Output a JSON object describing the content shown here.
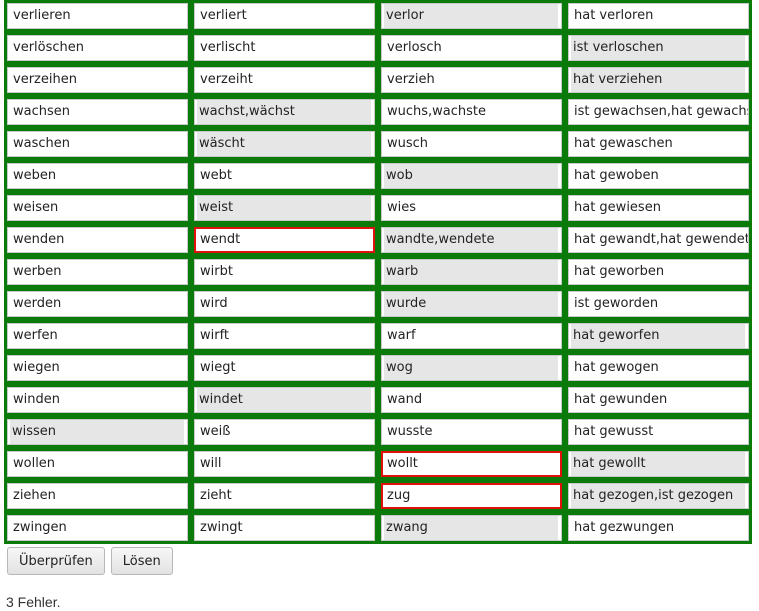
{
  "rows": [
    {
      "c": [
        {
          "t": "verlieren",
          "s": "given"
        },
        {
          "t": "verliert",
          "s": "given"
        },
        {
          "t": "verlor",
          "s": "ok"
        },
        {
          "t": "hat verloren",
          "s": "given"
        }
      ]
    },
    {
      "c": [
        {
          "t": "verlöschen",
          "s": "given"
        },
        {
          "t": "verlischt",
          "s": "given"
        },
        {
          "t": "verlosch",
          "s": "given"
        },
        {
          "t": "ist verloschen",
          "s": "ok"
        }
      ]
    },
    {
      "c": [
        {
          "t": "verzeihen",
          "s": "given"
        },
        {
          "t": "verzeiht",
          "s": "given"
        },
        {
          "t": "verzieh",
          "s": "given"
        },
        {
          "t": "hat verziehen",
          "s": "ok"
        }
      ]
    },
    {
      "c": [
        {
          "t": "wachsen",
          "s": "given"
        },
        {
          "t": "wachst,wächst",
          "s": "ok"
        },
        {
          "t": "wuchs,wachste",
          "s": "given"
        },
        {
          "t": "ist gewachsen,hat gewachst",
          "s": "given"
        }
      ]
    },
    {
      "c": [
        {
          "t": "waschen",
          "s": "given"
        },
        {
          "t": "wäscht",
          "s": "ok"
        },
        {
          "t": "wusch",
          "s": "given"
        },
        {
          "t": "hat gewaschen",
          "s": "given"
        }
      ]
    },
    {
      "c": [
        {
          "t": "weben",
          "s": "given"
        },
        {
          "t": "webt",
          "s": "given"
        },
        {
          "t": "wob",
          "s": "ok"
        },
        {
          "t": "hat gewoben",
          "s": "given"
        }
      ]
    },
    {
      "c": [
        {
          "t": "weisen",
          "s": "given"
        },
        {
          "t": "weist",
          "s": "ok"
        },
        {
          "t": "wies",
          "s": "given"
        },
        {
          "t": "hat gewiesen",
          "s": "given"
        }
      ]
    },
    {
      "c": [
        {
          "t": "wenden",
          "s": "given"
        },
        {
          "t": "wendt",
          "s": "bad"
        },
        {
          "t": "wandte,wendete",
          "s": "ok"
        },
        {
          "t": "hat gewandt,hat gewendet",
          "s": "given"
        }
      ]
    },
    {
      "c": [
        {
          "t": "werben",
          "s": "given"
        },
        {
          "t": "wirbt",
          "s": "given"
        },
        {
          "t": "warb",
          "s": "ok"
        },
        {
          "t": "hat geworben",
          "s": "given"
        }
      ]
    },
    {
      "c": [
        {
          "t": "werden",
          "s": "given"
        },
        {
          "t": "wird",
          "s": "given"
        },
        {
          "t": "wurde",
          "s": "ok"
        },
        {
          "t": "ist geworden",
          "s": "given"
        }
      ]
    },
    {
      "c": [
        {
          "t": "werfen",
          "s": "given"
        },
        {
          "t": "wirft",
          "s": "given"
        },
        {
          "t": "warf",
          "s": "given"
        },
        {
          "t": "hat geworfen",
          "s": "ok"
        }
      ]
    },
    {
      "c": [
        {
          "t": "wiegen",
          "s": "given"
        },
        {
          "t": "wiegt",
          "s": "given"
        },
        {
          "t": "wog",
          "s": "ok"
        },
        {
          "t": "hat gewogen",
          "s": "given"
        }
      ]
    },
    {
      "c": [
        {
          "t": "winden",
          "s": "given"
        },
        {
          "t": "windet",
          "s": "ok"
        },
        {
          "t": "wand",
          "s": "given"
        },
        {
          "t": "hat gewunden",
          "s": "given"
        }
      ]
    },
    {
      "c": [
        {
          "t": "wissen",
          "s": "ok"
        },
        {
          "t": "weiß",
          "s": "given"
        },
        {
          "t": "wusste",
          "s": "given"
        },
        {
          "t": "hat gewusst",
          "s": "given"
        }
      ]
    },
    {
      "c": [
        {
          "t": "wollen",
          "s": "given"
        },
        {
          "t": "will",
          "s": "given"
        },
        {
          "t": "wollt",
          "s": "bad"
        },
        {
          "t": "hat gewollt",
          "s": "ok"
        }
      ]
    },
    {
      "c": [
        {
          "t": "ziehen",
          "s": "given"
        },
        {
          "t": "zieht",
          "s": "given"
        },
        {
          "t": "zug",
          "s": "bad"
        },
        {
          "t": "hat gezogen,ist gezogen",
          "s": "ok"
        }
      ]
    },
    {
      "c": [
        {
          "t": "zwingen",
          "s": "given"
        },
        {
          "t": "zwingt",
          "s": "given"
        },
        {
          "t": "zwang",
          "s": "ok"
        },
        {
          "t": "hat gezwungen",
          "s": "given"
        }
      ]
    }
  ],
  "buttons": {
    "check_label": "Überprüfen",
    "solve_label": "Lösen"
  },
  "result_text": "3 Fehler.",
  "colors": {
    "grid": "#0a7a0a",
    "error": "#e01010",
    "filled": "#e6e6e6"
  }
}
